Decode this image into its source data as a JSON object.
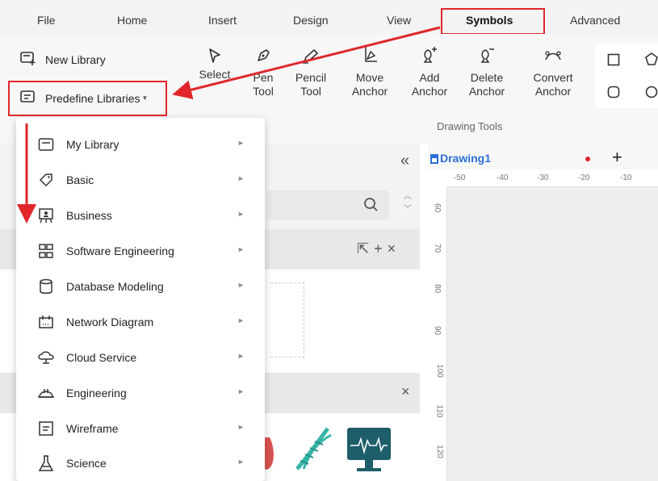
{
  "menubar": {
    "tabs": [
      "File",
      "Home",
      "Insert",
      "Design",
      "View",
      "Symbols",
      "Advanced"
    ],
    "active": "Symbols"
  },
  "ribbon": {
    "new_library": "New Library",
    "predefine_libraries": "Predefine Libraries",
    "tools": [
      {
        "line1": "Select",
        "line2": "",
        "icon": "select-arrow-icon"
      },
      {
        "line1": "Pen",
        "line2": "Tool",
        "icon": "pen-icon"
      },
      {
        "line1": "Pencil",
        "line2": "Tool",
        "icon": "pencil-icon"
      },
      {
        "line1": "Move",
        "line2": "Anchor",
        "icon": "move-anchor-icon"
      },
      {
        "line1": "Add",
        "line2": "Anchor",
        "icon": "add-anchor-icon"
      },
      {
        "line1": "Delete",
        "line2": "Anchor",
        "icon": "delete-anchor-icon"
      },
      {
        "line1": "Convert",
        "line2": "Anchor",
        "icon": "convert-anchor-icon"
      }
    ],
    "group_label": "Drawing Tools"
  },
  "canvas": {
    "doc_title": "Drawing1",
    "hruler": [
      "-50",
      "-40",
      "-30",
      "-20",
      "-10"
    ],
    "vruler": [
      "60",
      "70",
      "80",
      "90",
      "100",
      "110",
      "120"
    ]
  },
  "dropdown": {
    "items": [
      {
        "label": "My Library",
        "icon": "folder-icon"
      },
      {
        "label": "Basic",
        "icon": "tag-icon"
      },
      {
        "label": "Business",
        "icon": "presentation-icon"
      },
      {
        "label": "Software Engineering",
        "icon": "hierarchy-icon"
      },
      {
        "label": "Database Modeling",
        "icon": "database-icon"
      },
      {
        "label": "Network Diagram",
        "icon": "network-icon"
      },
      {
        "label": "Cloud Service",
        "icon": "cloud-icon"
      },
      {
        "label": "Engineering",
        "icon": "hardhat-icon"
      },
      {
        "label": "Wireframe",
        "icon": "wireframe-icon"
      },
      {
        "label": "Science",
        "icon": "flask-icon"
      }
    ]
  },
  "colors": {
    "annotation_red": "#e0262b",
    "doc_title_blue": "#2a6fd6"
  }
}
